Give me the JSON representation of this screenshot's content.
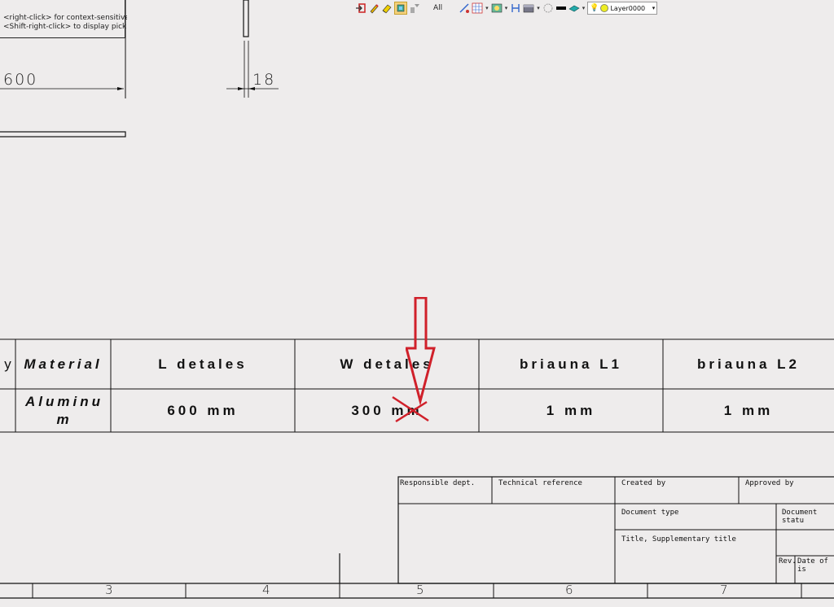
{
  "tooltip": {
    "line1": "<right-click> for context-sensitive options.",
    "line2": "<Shift-right-click> to display pick filter"
  },
  "toolbar": {
    "all_label": "All",
    "layer_name": "Layer0000",
    "icons": [
      "exit-icon",
      "pencil-icon",
      "eraser-icon",
      "select-icon",
      "filter-icon",
      "grid-icon",
      "snap-icon",
      "save-view-icon",
      "display-icon",
      "hidden-icon",
      "color-icon",
      "layer-icon"
    ]
  },
  "dimensions": {
    "width_label": "600",
    "thickness_label": "18"
  },
  "parts_table": {
    "headers": [
      "y",
      "Material",
      "L detales",
      "W detales",
      "briauna L1",
      "briauna L2"
    ],
    "row": [
      "",
      "Aluminum",
      "600 mm",
      "300 mm",
      "1 mm",
      "1 mm"
    ]
  },
  "title_block": {
    "responsible_dept": "Responsible dept.",
    "technical_reference": "Technical reference",
    "created_by": "Created by",
    "approved_by": "Approved by",
    "document_type": "Document type",
    "document_status": "Document statu",
    "title": "Title, Supplementary title",
    "rev": "Rev.",
    "date_of_issue": "Date of is"
  },
  "zones": [
    "3",
    "4",
    "5",
    "6",
    "7"
  ],
  "colors": {
    "annotation": "#d0202a",
    "background": "#eeecec",
    "line": "#111111"
  }
}
